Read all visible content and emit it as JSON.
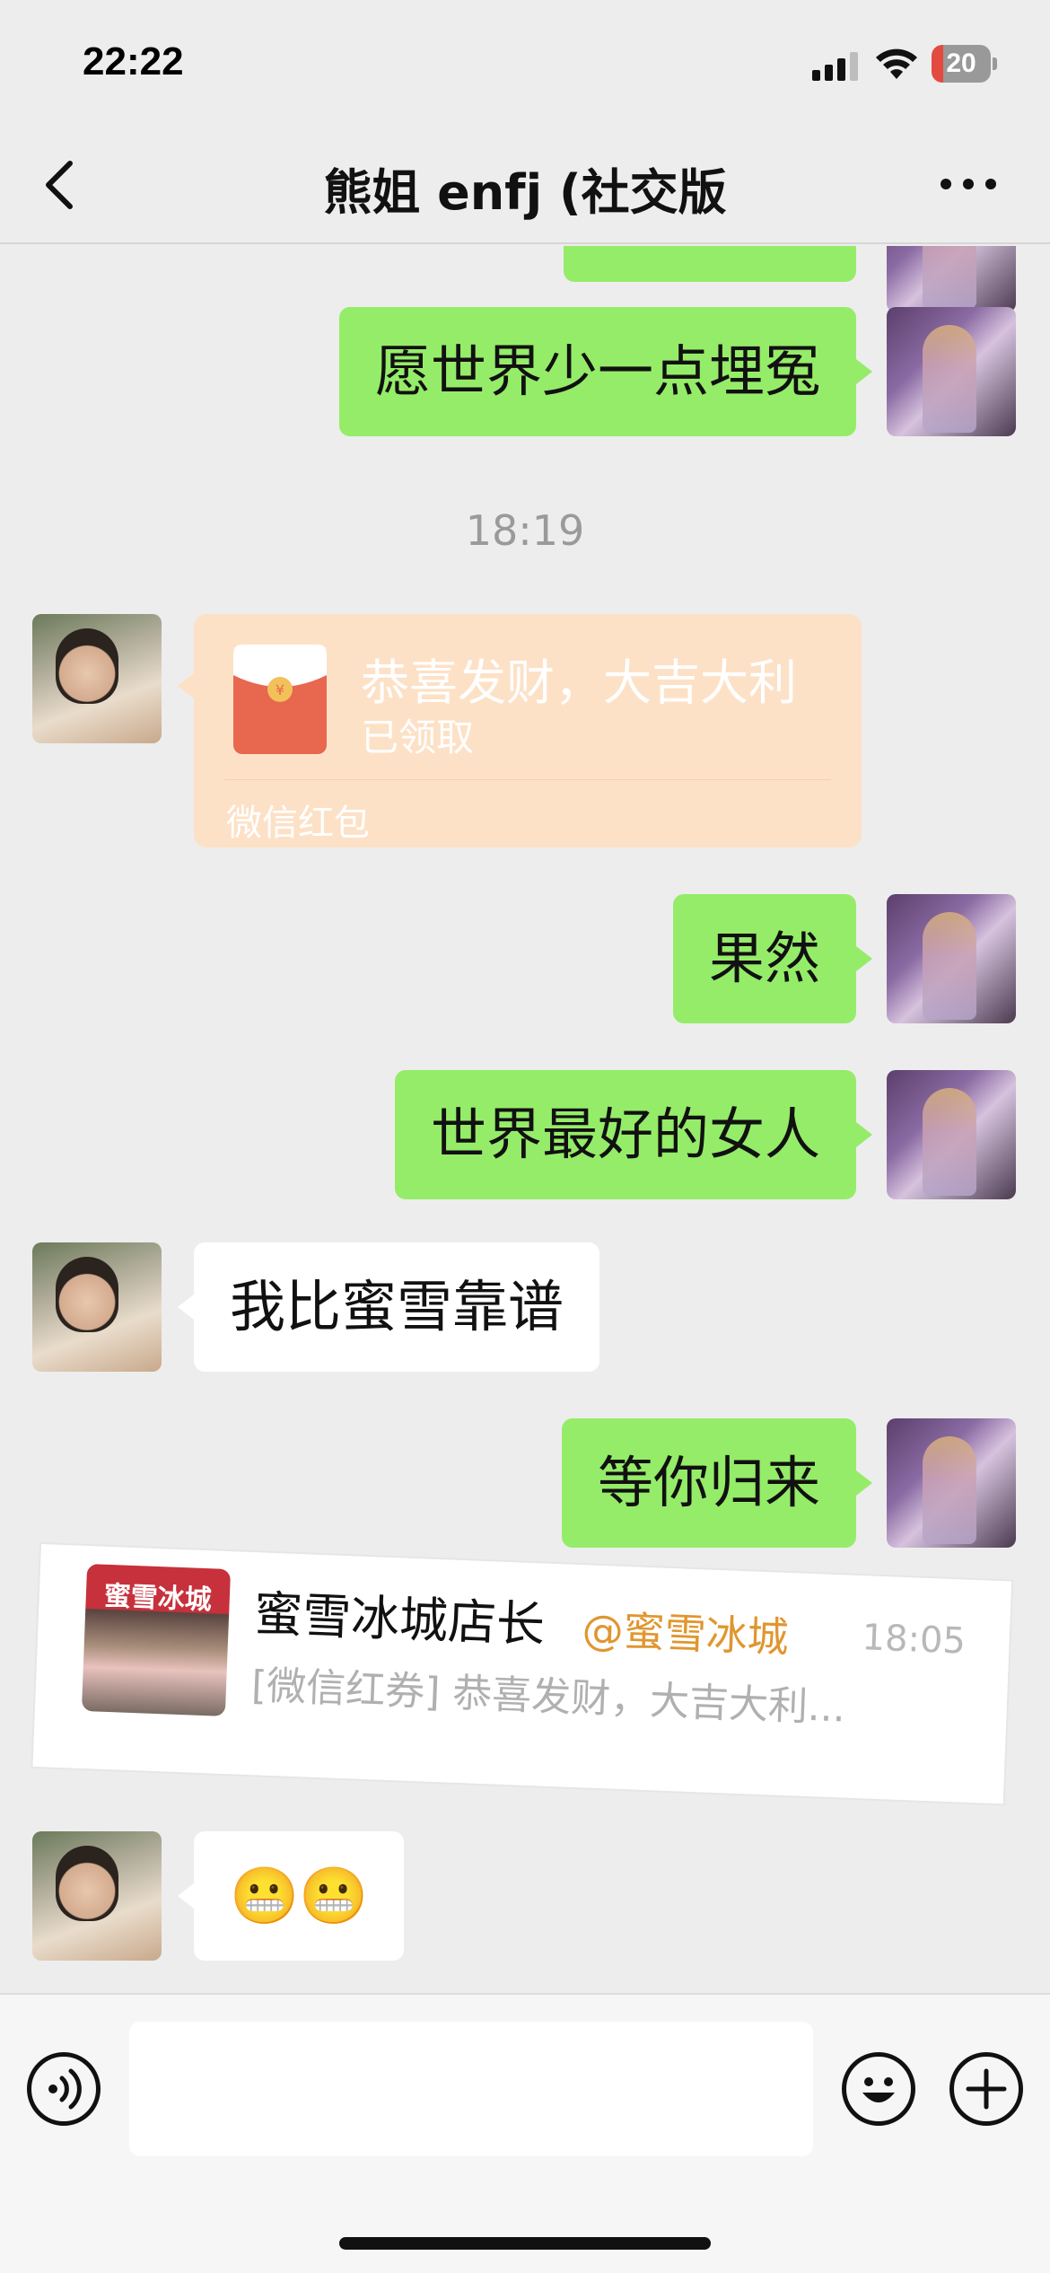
{
  "status_bar": {
    "time": "22:22",
    "battery_level": "20",
    "battery_fraction": 0.2,
    "battery_color": "#e34b3e"
  },
  "nav": {
    "title": "熊姐 enfj (社交版",
    "back_icon": "chevron-left-icon",
    "more_icon": "more-dots-icon"
  },
  "messages": [
    {
      "side": "self",
      "text": "愿世界少一点埋冤"
    },
    {
      "type": "time",
      "text": "18:19"
    },
    {
      "side": "other",
      "type": "red-packet",
      "title": "恭喜发财，大吉大利",
      "status": "已领取",
      "footer": "微信红包"
    },
    {
      "side": "self",
      "text": "果然"
    },
    {
      "side": "self",
      "text": "世界最好的女人"
    },
    {
      "side": "other",
      "text": "我比蜜雪靠谱"
    },
    {
      "side": "self",
      "text": "等你归来"
    },
    {
      "side": "other",
      "text": "😬😬"
    }
  ],
  "notification": {
    "thumb_label": "蜜雪冰城",
    "name": "蜜雪冰城店长",
    "mention": "@蜜雪冰城",
    "time": "18:05",
    "preview": "[微信红券] 恭喜发财，大吉大利..."
  },
  "input_bar": {
    "placeholder": "",
    "voice_icon": "voice-icon",
    "emoji_icon": "emoji-icon",
    "add_icon": "add-icon"
  },
  "colors": {
    "self_bubble": "#95ec69",
    "other_bubble": "#ffffff",
    "red_packet": "#fde1c6",
    "background": "#ededed"
  }
}
